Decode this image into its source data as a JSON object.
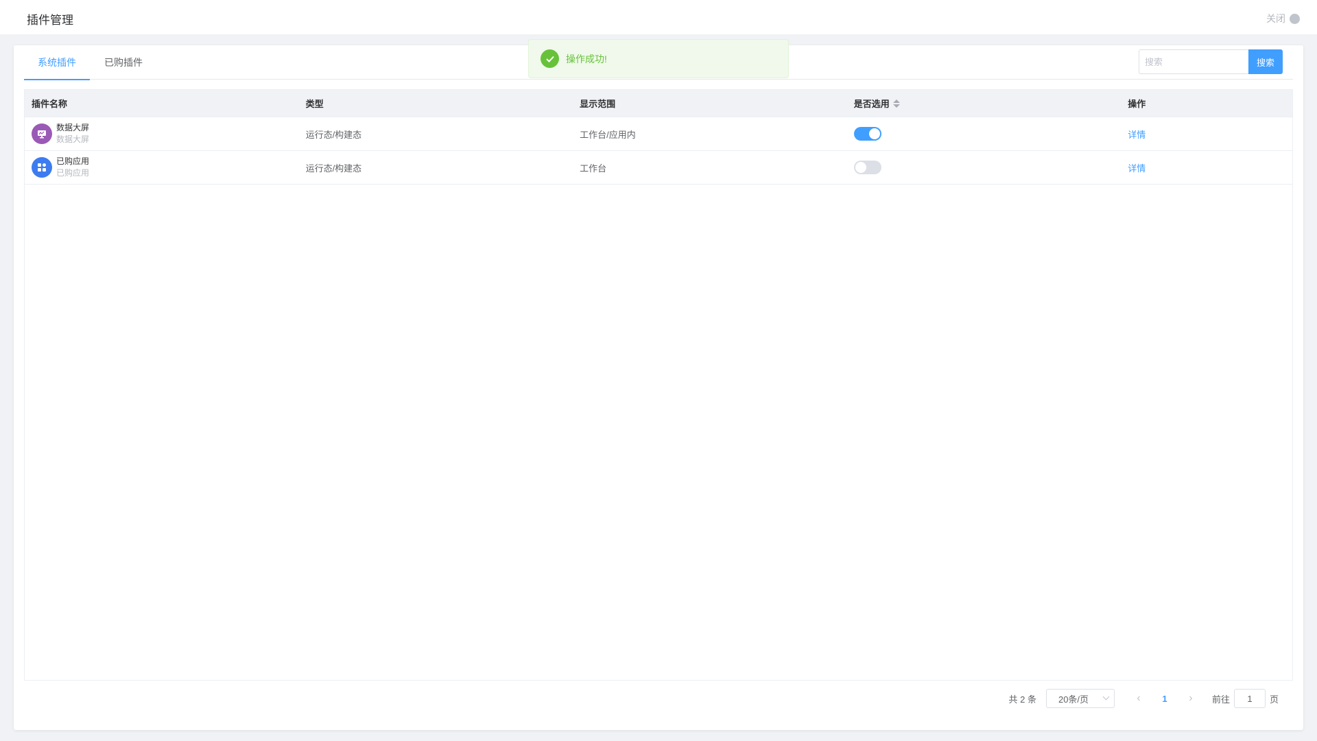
{
  "header": {
    "title": "插件管理",
    "close_label": "关闭"
  },
  "tabs": [
    {
      "label": "系统插件",
      "active": true
    },
    {
      "label": "已购插件",
      "active": false
    }
  ],
  "search": {
    "placeholder": "搜索",
    "button_label": "搜索"
  },
  "table": {
    "columns": [
      "插件名称",
      "类型",
      "显示范围",
      "是否选用",
      "操作"
    ],
    "rows": [
      {
        "name": "数据大屏",
        "subtitle": "数据大屏",
        "type": "运行态/构建态",
        "scope": "工作台/应用内",
        "enabled": true,
        "action": "详情",
        "icon": "dashboard-screen-icon",
        "icon_color": "#9b59b6"
      },
      {
        "name": "已购应用",
        "subtitle": "已购应用",
        "type": "运行态/构建态",
        "scope": "工作台",
        "enabled": false,
        "action": "详情",
        "icon": "apps-grid-icon",
        "icon_color": "#3d7cf0"
      }
    ]
  },
  "pagination": {
    "total_text": "共 2 条",
    "page_size": "20条/页",
    "current_page": "1",
    "goto_prefix": "前往",
    "goto_value": "1",
    "goto_suffix": "页"
  },
  "toast": {
    "message": "操作成功!",
    "type": "success"
  },
  "colors": {
    "accent": "#409eff",
    "success": "#67c23a"
  }
}
